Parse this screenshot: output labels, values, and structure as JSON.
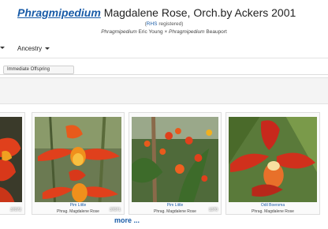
{
  "header": {
    "genus": "Phragmipedium",
    "title_rest": "Magdalene Rose, Orch.by Ackers 2001",
    "registration_open": "(",
    "rhs_link": "RHS",
    "registration_rest": " registered)",
    "parent1_genus": "Phragmipedium",
    "parent1_name": " Eric Young × ",
    "parent2_genus": "Phragmipedium",
    "parent2_name": " Beauport"
  },
  "nav": {
    "ancestry_label": "Ancestry"
  },
  "subtab": {
    "label": "Immediate Offspring"
  },
  "gallery": {
    "cards": [
      {
        "number": "37072",
        "name": "",
        "sub": ""
      },
      {
        "number": "37071",
        "name": "Pim Little",
        "sub": "Phrag. Magdalene Rose"
      },
      {
        "number": "1070",
        "name": "Pim Little",
        "sub": "Phrag. Magdalene Rose"
      },
      {
        "number": "",
        "name": "Odil Boersma",
        "sub": "Phrag. Magdalene Rose"
      }
    ],
    "more_label": "more ..."
  },
  "colors": {
    "link": "#1a5ca8",
    "flower": "#e0401c",
    "leaf": "#3d6b2a"
  }
}
